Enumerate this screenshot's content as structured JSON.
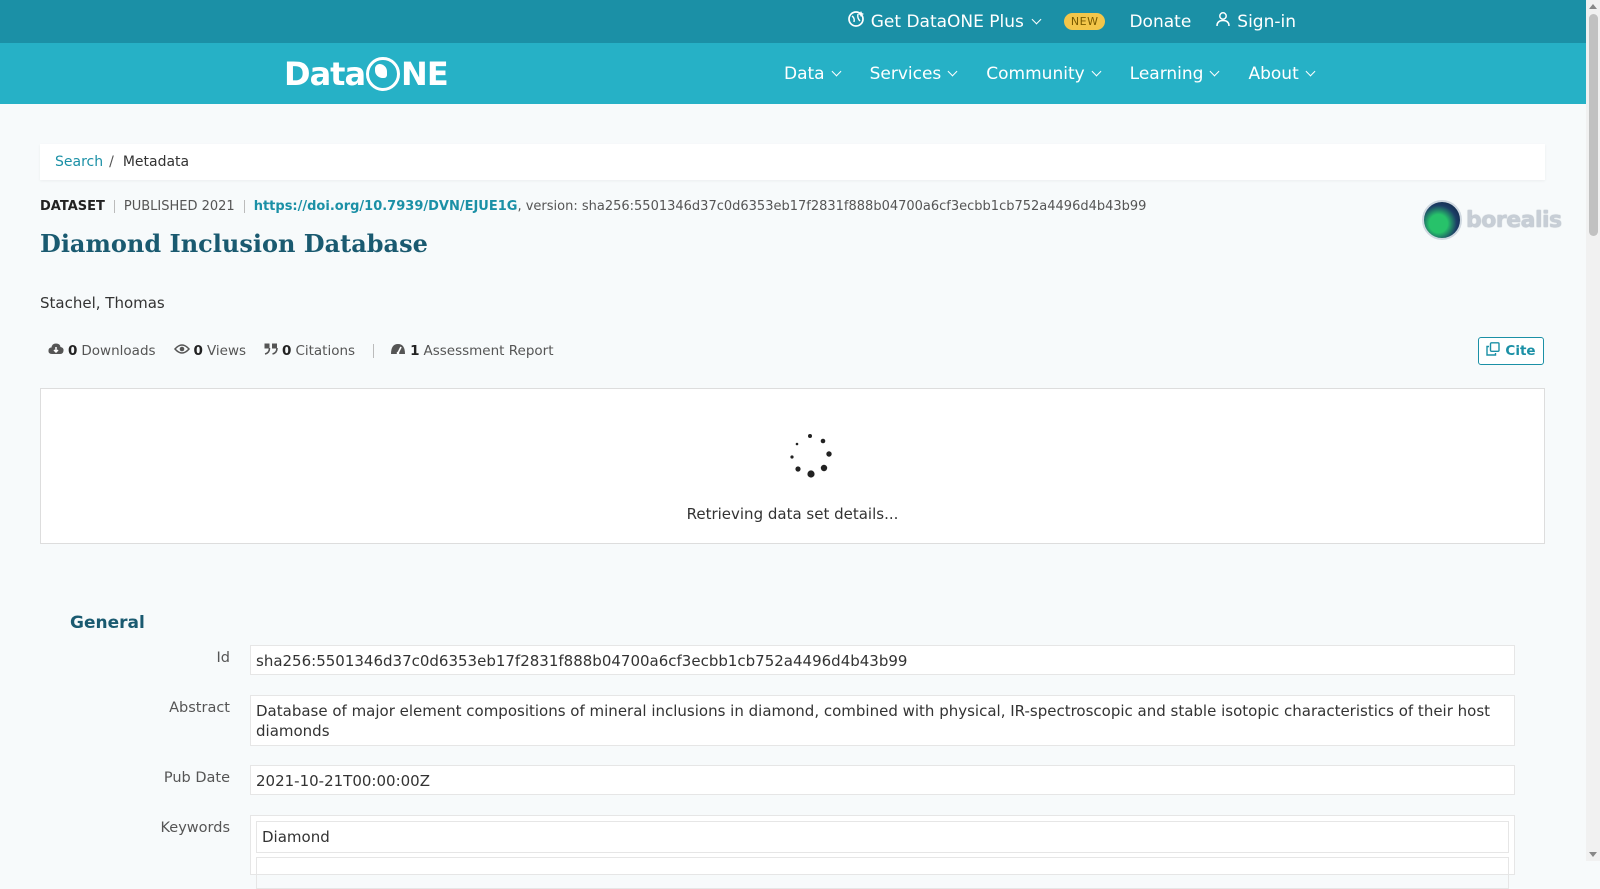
{
  "topbar": {
    "plus_label": "Get DataONE Plus",
    "new_badge": "NEW",
    "donate_label": "Donate",
    "signin_label": "Sign-in"
  },
  "navbar": {
    "logo_text_left": "Data",
    "logo_text_right": "NE",
    "links": [
      "Data",
      "Services",
      "Community",
      "Learning",
      "About"
    ]
  },
  "breadcrumb": {
    "search": "Search",
    "separator": "/",
    "current": "Metadata"
  },
  "dataset": {
    "type": "DATASET",
    "published": "PUBLISHED 2021",
    "doi": "https://doi.org/10.7939/DVN/EJUE1G",
    "version_text": ", version: sha256:5501346d37c0d6353eb17f2831f888b04700a6cf3ecbb1cb752a4496d4b43b99",
    "title": "Diamond Inclusion Database",
    "author": "Stachel, Thomas",
    "repository": "borealis"
  },
  "metrics": {
    "downloads_count": "0",
    "downloads_label": "Downloads",
    "views_count": "0",
    "views_label": "Views",
    "citations_count": "0",
    "citations_label": "Citations",
    "assessment_count": "1",
    "assessment_label": "Assessment Report"
  },
  "cite_label": "Cite",
  "loading": {
    "text": "Retrieving data set details..."
  },
  "general": {
    "heading": "General",
    "fields": {
      "id_label": "Id",
      "id_value": "sha256:5501346d37c0d6353eb17f2831f888b04700a6cf3ecbb1cb752a4496d4b43b99",
      "abstract_label": "Abstract",
      "abstract_value": "Database of major element compositions of mineral inclusions in diamond, combined with physical, IR-spectroscopic and stable isotopic characteristics of their host diamonds",
      "pubdate_label": "Pub Date",
      "pubdate_value": "2021-10-21T00:00:00Z",
      "keywords_label": "Keywords",
      "keywords": [
        "Diamond"
      ]
    }
  },
  "colors": {
    "topbar": "#1b90a6",
    "navbar": "#26b1c6",
    "accent": "#1b90a6",
    "badge": "#f3c64a"
  }
}
